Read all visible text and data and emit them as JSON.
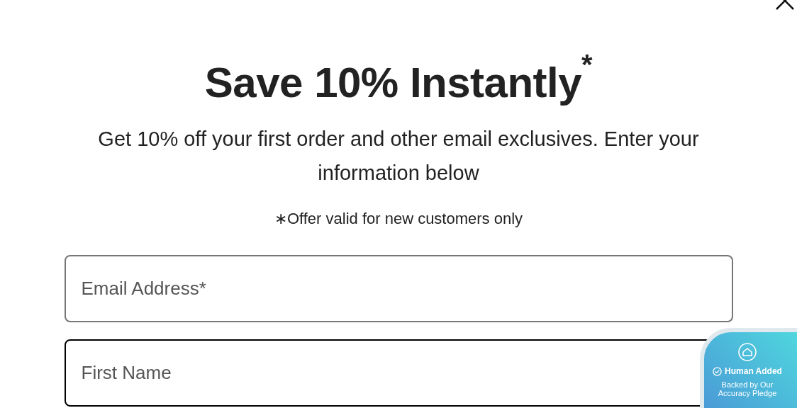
{
  "title": "Save 10% Instantly$^{*}$",
  "subtitle": "Get 10% off your first order and other email exclusives. Enter your information below",
  "note": "∗Offer valid for new customers only",
  "fields": [
    {
      "placeholder": "Email Address*",
      "focused": false
    },
    {
      "placeholder": "First Name",
      "focused": true
    }
  ],
  "badge": {
    "title": "Human Added",
    "subtitle": "Backed by Our Accuracy Pledge"
  }
}
